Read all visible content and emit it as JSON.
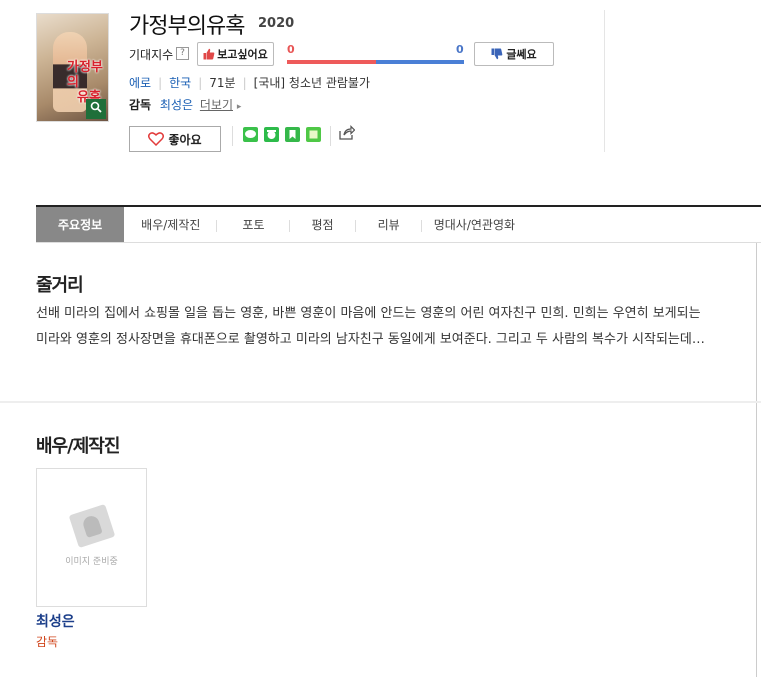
{
  "movie": {
    "poster_title_line1": "가정부의",
    "poster_title_line2": "유혹",
    "poster_zoom_icon": "search-icon",
    "title": "가정부의유혹",
    "year": "2020",
    "expectation_label": "기대지수",
    "help_glyph": "?",
    "want_label": "보고싶어요",
    "want_count": "0",
    "meh_label": "글쎄요",
    "meh_count": "0",
    "bar_left_fraction": 0.5,
    "genre": "에로",
    "country": "한국",
    "runtime": "71분",
    "rating": "[국내] 청소년 관람불가",
    "director_label": "감독",
    "director_name": "최성은",
    "more_link": "더보기",
    "like_label": "좋아요"
  },
  "colors": {
    "like_red": "#e85555",
    "meh_blue": "#4a76c8",
    "link_blue": "#1a5fb4",
    "role_orange": "#d0451b"
  },
  "share_icons": [
    "line-icon",
    "kakao-icon",
    "bookmark-icon",
    "memo-icon",
    "share-out-icon"
  ],
  "tabs": [
    "주요정보",
    "배우/제작진",
    "포토",
    "평점",
    "리뷰",
    "명대사/연관영화"
  ],
  "synopsis": {
    "heading": "줄거리",
    "text": "선배 미라의 집에서 쇼핑몰 일을 돕는 영훈, 바쁜 영훈이 마음에 안드는 영훈의 어린 여자친구 민희. 민희는 우연히 보게되는 미라와 영훈의 정사장면을 휴대폰으로 촬영하고 미라의 남자친구 동일에게 보여준다. 그리고 두 사람의 복수가 시작되는데…"
  },
  "cast": {
    "heading": "배우/제작진",
    "placeholder_text": "이미지 준비중",
    "members": [
      {
        "name": "최성은",
        "role": "감독"
      }
    ]
  }
}
